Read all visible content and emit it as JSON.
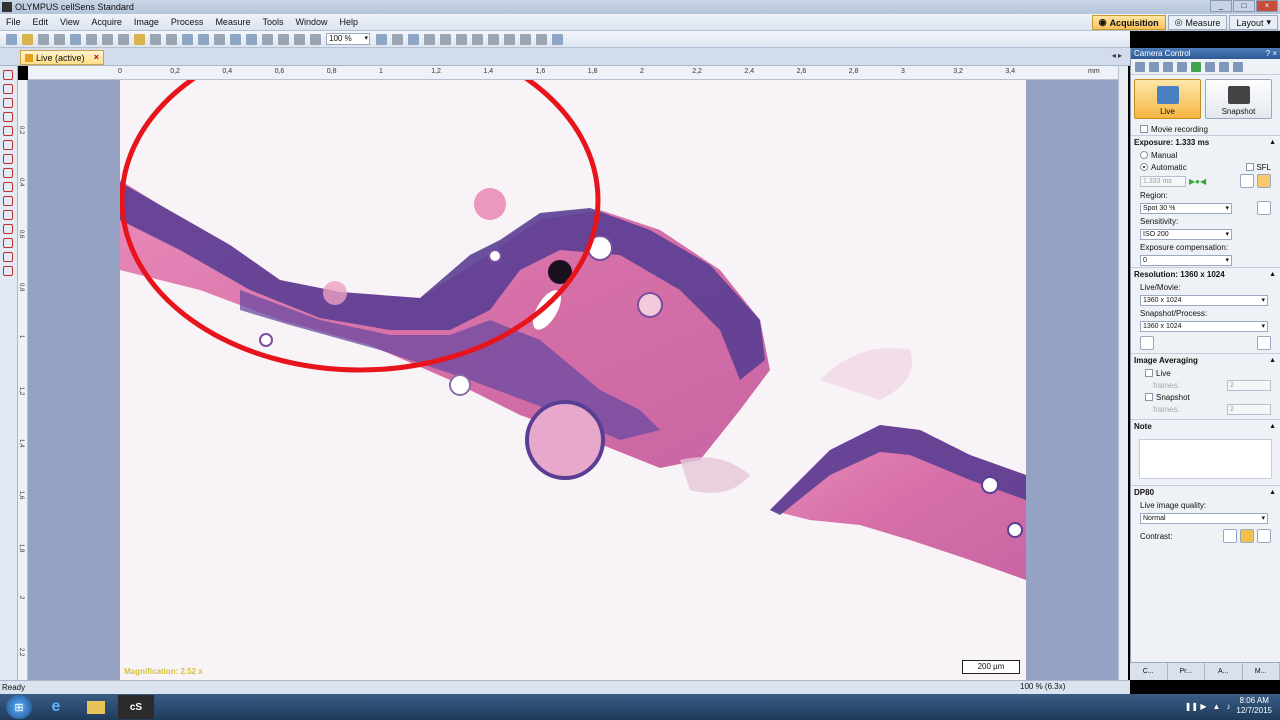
{
  "window": {
    "title": "OLYMPUS cellSens Standard"
  },
  "menu": [
    "File",
    "Edit",
    "View",
    "Acquire",
    "Image",
    "Process",
    "Measure",
    "Tools",
    "Window",
    "Help"
  ],
  "modes": {
    "acquisition": "Acquisition",
    "measure": "Measure",
    "layout": "Layout"
  },
  "toolbar": {
    "zoom": "100 %"
  },
  "doc_tab": {
    "label": "Live (active)"
  },
  "ruler": {
    "h_ticks": [
      "0",
      "0,2",
      "0,4",
      "0,6",
      "0,8",
      "1",
      "1,2",
      "1,4",
      "1,6",
      "1,8",
      "2",
      "2,2",
      "2,4",
      "2,6",
      "2,8",
      "3",
      "3,2",
      "3,4"
    ],
    "h_unit": "mm",
    "v_ticks": [
      "0,2",
      "0,4",
      "0,6",
      "0,8",
      "1",
      "1,2",
      "1,4",
      "1,6",
      "1,8",
      "2",
      "2,2"
    ]
  },
  "image": {
    "magnification": "Magnification:  2.52 x",
    "scalebar": "200 µm",
    "annotation_color": "#e8141c"
  },
  "status": {
    "text": "Ready",
    "zoom": "100 % (6.3x)"
  },
  "camera_control": {
    "title": "Camera Control",
    "live": "Live",
    "snapshot": "Snapshot",
    "movie_recording": "Movie recording",
    "exposure": {
      "header": "Exposure: 1.333 ms",
      "manual": "Manual",
      "automatic": "Automatic",
      "sfl": "SFL",
      "value": "1.333 ms",
      "region_label": "Region:",
      "region": "Spot 30 %",
      "sensitivity_label": "Sensitivity:",
      "sensitivity": "ISO 200",
      "comp_label": "Exposure compensation:",
      "comp": "0"
    },
    "resolution": {
      "header": "Resolution: 1360 x 1024",
      "live_label": "Live/Movie:",
      "live": "1360 x 1024",
      "snap_label": "Snapshot/Process:",
      "snap": "1360 x 1024"
    },
    "averaging": {
      "header": "Image Averaging",
      "live": "Live",
      "snapshot": "Snapshot",
      "frames_label": "frames:",
      "frames": "2"
    },
    "note": {
      "header": "Note"
    },
    "dp80": {
      "header": "DP80",
      "quality_label": "Live image quality:",
      "quality": "Normal",
      "contrast": "Contrast:"
    }
  },
  "panel_tabs": [
    "C...",
    "Pr...",
    "A...",
    "M..."
  ],
  "taskbar": {
    "cs": "cS",
    "time": "8:06 AM",
    "date": "12/7/2015"
  }
}
